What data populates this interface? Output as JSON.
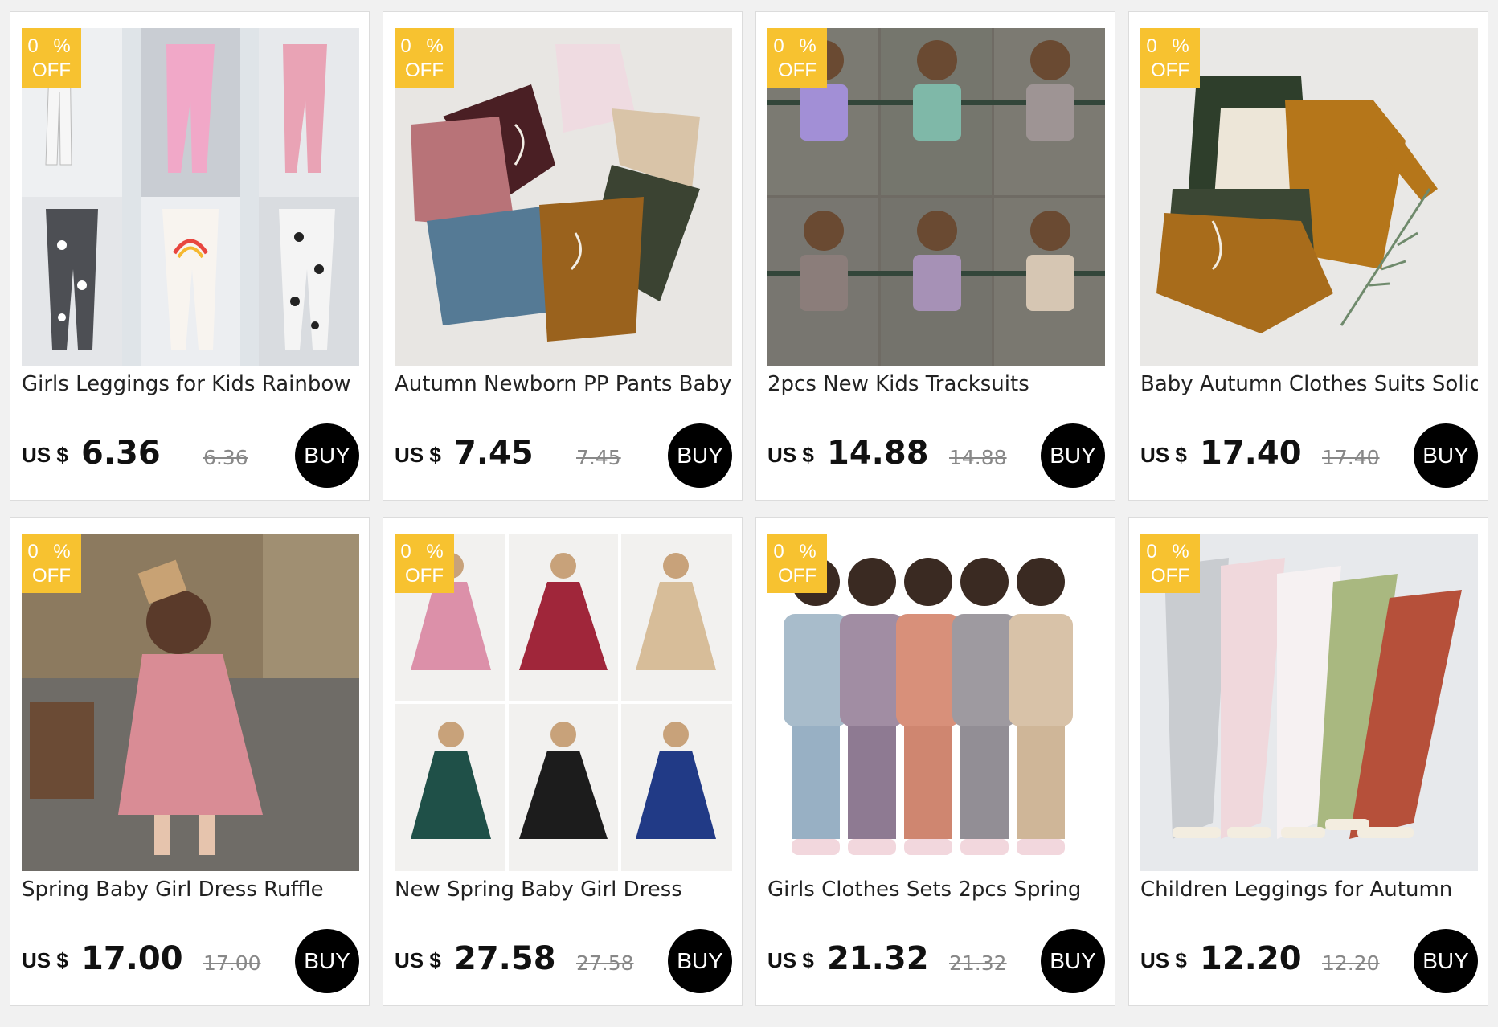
{
  "products": [
    {
      "discount_value": "0",
      "discount_symbol": "%",
      "discount_off": "OFF",
      "title": "Girls Leggings for Kids Rainbow",
      "currency": "US $",
      "price": "6.36",
      "old_price": "6.36",
      "buy_label": "BUY",
      "image": "leggings-collage"
    },
    {
      "discount_value": "0",
      "discount_symbol": "%",
      "discount_off": "OFF",
      "title": "Autumn Newborn PP Pants Baby",
      "currency": "US $",
      "price": "7.45",
      "old_price": "7.45",
      "buy_label": "BUY",
      "image": "baby-pants-fan"
    },
    {
      "discount_value": "0",
      "discount_symbol": "%",
      "discount_off": "OFF",
      "title": "2pcs New Kids Tracksuits",
      "currency": "US $",
      "price": "14.88",
      "old_price": "14.88",
      "buy_label": "BUY",
      "image": "tracksuits-grid"
    },
    {
      "discount_value": "0",
      "discount_symbol": "%",
      "discount_off": "OFF",
      "title": "Baby Autumn Clothes Suits Solid",
      "currency": "US $",
      "price": "17.40",
      "old_price": "17.40",
      "buy_label": "BUY",
      "image": "baby-suits-flatlay"
    },
    {
      "discount_value": "0",
      "discount_symbol": "%",
      "discount_off": "OFF",
      "title": "Spring Baby Girl Dress Ruffle",
      "currency": "US $",
      "price": "17.00",
      "old_price": "17.00",
      "buy_label": "BUY",
      "image": "pink-dress-photo"
    },
    {
      "discount_value": "0",
      "discount_symbol": "%",
      "discount_off": "OFF",
      "title": "New Spring Baby Girl Dress",
      "currency": "US $",
      "price": "27.58",
      "old_price": "27.58",
      "buy_label": "BUY",
      "image": "dress-colors-grid"
    },
    {
      "discount_value": "0",
      "discount_symbol": "%",
      "discount_off": "OFF",
      "title": "Girls Clothes Sets 2pcs Spring",
      "currency": "US $",
      "price": "21.32",
      "old_price": "21.32",
      "buy_label": "BUY",
      "image": "girls-sets-lineup"
    },
    {
      "discount_value": "0",
      "discount_symbol": "%",
      "discount_off": "OFF",
      "title": "Children Leggings for Autumn",
      "currency": "US $",
      "price": "12.20",
      "old_price": "12.20",
      "buy_label": "BUY",
      "image": "leggings-lace-flatlay"
    }
  ],
  "colors": {
    "badge": "#f7c230",
    "buy_button": "#000000",
    "card_background": "#ffffff",
    "page_background": "#f1f1f1"
  }
}
